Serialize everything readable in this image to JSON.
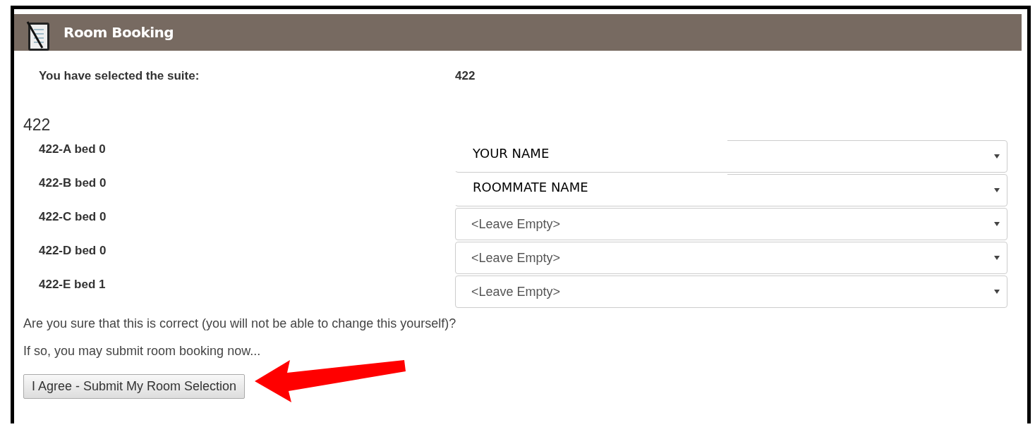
{
  "panel": {
    "title": "Room Booking"
  },
  "selection": {
    "label": "You have selected the suite:",
    "value": "422"
  },
  "suite": {
    "heading": "422",
    "beds": [
      {
        "label": "422-A bed 0",
        "kind": "overlay",
        "value": "YOUR NAME"
      },
      {
        "label": "422-B bed 0",
        "kind": "overlay",
        "value": "ROOMMATE NAME"
      },
      {
        "label": "422-C bed 0",
        "kind": "select",
        "value": "<Leave Empty>"
      },
      {
        "label": "422-D bed 0",
        "kind": "select",
        "value": "<Leave Empty>"
      },
      {
        "label": "422-E bed 1",
        "kind": "select",
        "value": "<Leave Empty>"
      }
    ]
  },
  "confirm": {
    "question": "Are you sure that this is correct (you will not be able to change this yourself)?",
    "note": "If so, you may submit room booking now...",
    "button": "I Agree - Submit My Room Selection"
  }
}
